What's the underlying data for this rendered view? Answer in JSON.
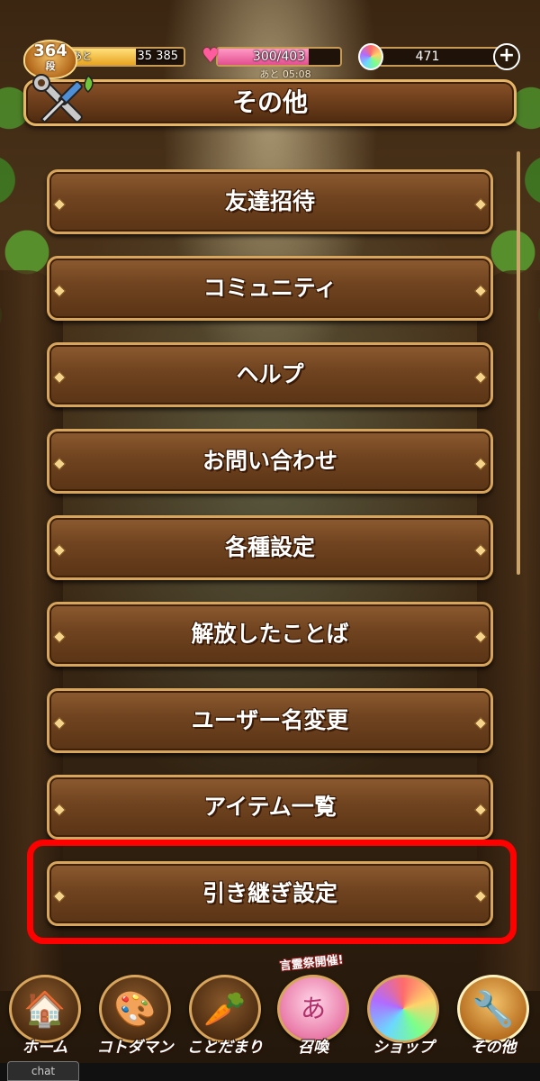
{
  "status": {
    "rank_number": "364",
    "rank_unit": "段",
    "exp_prefix": "あと",
    "exp_remaining": "35",
    "exp_total": "385",
    "exp_fill_fraction": 0.6,
    "stamina": "300/403",
    "stamina_fill_fraction": 0.74,
    "stamina_timer": "あと 05:08",
    "gems": "471",
    "plus_label": "+"
  },
  "header": {
    "title": "その他"
  },
  "menu": {
    "items": [
      {
        "label": "友達招待"
      },
      {
        "label": "コミュニティ"
      },
      {
        "label": "ヘルプ"
      },
      {
        "label": "お問い合わせ"
      },
      {
        "label": "各種設定"
      },
      {
        "label": "解放したことば"
      },
      {
        "label": "ユーザー名変更"
      },
      {
        "label": "アイテム一覧"
      },
      {
        "label": "引き継ぎ設定"
      }
    ],
    "highlighted_index": 8
  },
  "bottom_nav": {
    "event_banner": "言霊祭開催!",
    "items": [
      {
        "label": "ホーム",
        "icon": "house-icon"
      },
      {
        "label": "コトダマン",
        "icon": "kotodaman-icon"
      },
      {
        "label": "ことだまり",
        "icon": "kotodamari-icon"
      },
      {
        "label": "召喚",
        "icon": "summon-icon"
      },
      {
        "label": "ショップ",
        "icon": "shop-icon"
      },
      {
        "label": "その他",
        "icon": "tools-icon"
      }
    ],
    "active_index": 5
  },
  "chat": {
    "label": "chat"
  },
  "colors": {
    "highlight": "#ff0000",
    "frame_gold": "#d8a55c",
    "button_brown": "#6f431f",
    "stamina_pink": "#e24f8f",
    "exp_yellow": "#e8a422"
  }
}
